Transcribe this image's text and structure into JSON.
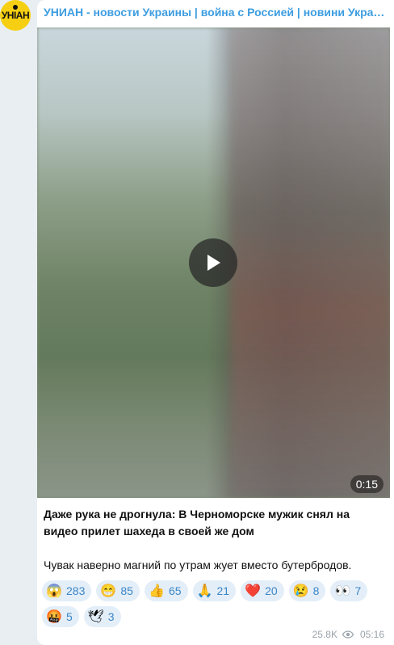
{
  "channel": {
    "avatar_text": "УНІАН",
    "title": "УНИАН - новости Украины | война с Россией | новини України..."
  },
  "post": {
    "video": {
      "duration": "0:15"
    },
    "caption_title": "Даже рука не дрогнула: В Черноморске мужик снял на видео прилет шахеда в своей же дом",
    "caption_body": "Чувак наверно магний по утрам жует вместо бутербродов.",
    "reactions": [
      {
        "emoji": "😱",
        "count": "283",
        "icon": "screaming-face-icon"
      },
      {
        "emoji": "😁",
        "count": "85",
        "icon": "grinning-face-icon"
      },
      {
        "emoji": "👍",
        "count": "65",
        "icon": "thumbs-up-icon"
      },
      {
        "emoji": "🙏",
        "count": "21",
        "icon": "folded-hands-icon"
      },
      {
        "emoji": "❤️",
        "count": "20",
        "icon": "red-heart-icon"
      },
      {
        "emoji": "😢",
        "count": "8",
        "icon": "crying-face-icon"
      },
      {
        "emoji": "👀",
        "count": "7",
        "icon": "eyes-icon"
      },
      {
        "emoji": "🤬",
        "count": "5",
        "icon": "cursing-face-icon"
      },
      {
        "emoji": "🕊",
        "count": "3",
        "icon": "dove-icon"
      }
    ],
    "views": "25.8K",
    "time": "05:16"
  },
  "colors": {
    "background": "#e9eef2",
    "bubble": "#ffffff",
    "title_blue": "#3d9de1",
    "reaction_bg": "#e3eef8",
    "reaction_count": "#3d86c6",
    "meta_gray": "#9aa3ab",
    "avatar_yellow": "#f6cf12"
  }
}
